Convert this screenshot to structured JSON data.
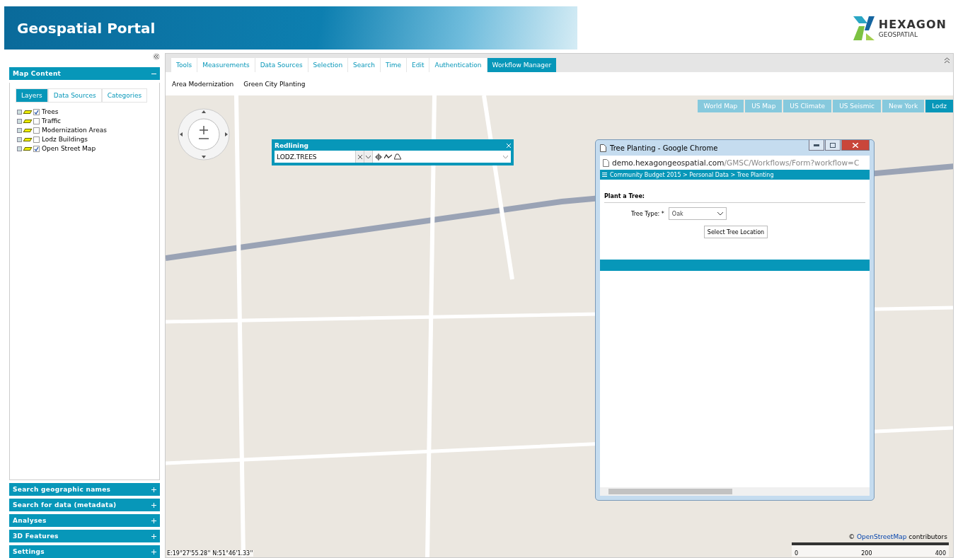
{
  "header": {
    "title": "Geospatial Portal",
    "logo_name": "HEXAGON",
    "logo_sub": "GEOSPATIAL"
  },
  "sidebar": {
    "map_content": {
      "title": "Map Content",
      "expanded": true,
      "tabs": [
        {
          "label": "Layers",
          "selected": true
        },
        {
          "label": "Data Sources",
          "selected": false
        },
        {
          "label": "Categories",
          "selected": false
        }
      ],
      "layers": [
        {
          "name": "Trees",
          "checked": true
        },
        {
          "name": "Traffic",
          "checked": false
        },
        {
          "name": "Modernization Areas",
          "checked": false
        },
        {
          "name": "Lodz Buildings",
          "checked": false
        },
        {
          "name": "Open Street Map",
          "checked": true
        }
      ]
    },
    "panels": [
      {
        "title": "Search geographic names",
        "expanded": false
      },
      {
        "title": "Search for data (metadata)",
        "expanded": false
      },
      {
        "title": "Analyses",
        "expanded": false
      },
      {
        "title": "3D Features",
        "expanded": false
      },
      {
        "title": "Settings",
        "expanded": false
      }
    ]
  },
  "toolbar": {
    "tabs": [
      {
        "label": "Tools",
        "selected": false
      },
      {
        "label": "Measurements",
        "selected": false
      },
      {
        "label": "Data Sources",
        "selected": false
      },
      {
        "label": "Selection",
        "selected": false
      },
      {
        "label": "Search",
        "selected": false
      },
      {
        "label": "Time",
        "selected": false
      },
      {
        "label": "Edit",
        "selected": false
      },
      {
        "label": "Authentication",
        "selected": false
      },
      {
        "label": "Workflow Manager",
        "selected": true
      }
    ],
    "workflows": [
      "Area Modernization",
      "Green City Planting"
    ]
  },
  "map": {
    "basemaps": [
      {
        "label": "World Map",
        "selected": false
      },
      {
        "label": "US Map",
        "selected": false
      },
      {
        "label": "US Climate",
        "selected": false
      },
      {
        "label": "US Seismic",
        "selected": false
      },
      {
        "label": "New York",
        "selected": false
      },
      {
        "label": "Lodz",
        "selected": true
      }
    ],
    "redlining": {
      "title": "Redlining",
      "value": "LODZ.TREES"
    },
    "coordinates": "E:19°27'55.28'' N:51°46'1.33''",
    "attribution": {
      "prefix": "©",
      "link": "OpenStreetMap",
      "suffix": "contributors"
    },
    "scale": [
      "0",
      "200",
      "400"
    ]
  },
  "popup": {
    "title": "Tree Planting - Google Chrome",
    "url_host": "demo.hexagongeospatial.com",
    "url_path": "/GMSC/Workflows/Form?workflow=C",
    "breadcrumb": "Community Budget 2015 > Personal Data > Tree Planting",
    "form_title": "Plant a Tree:",
    "field_label": "Tree Type: *",
    "field_value": "Oak",
    "button": "Select Tree Location"
  }
}
